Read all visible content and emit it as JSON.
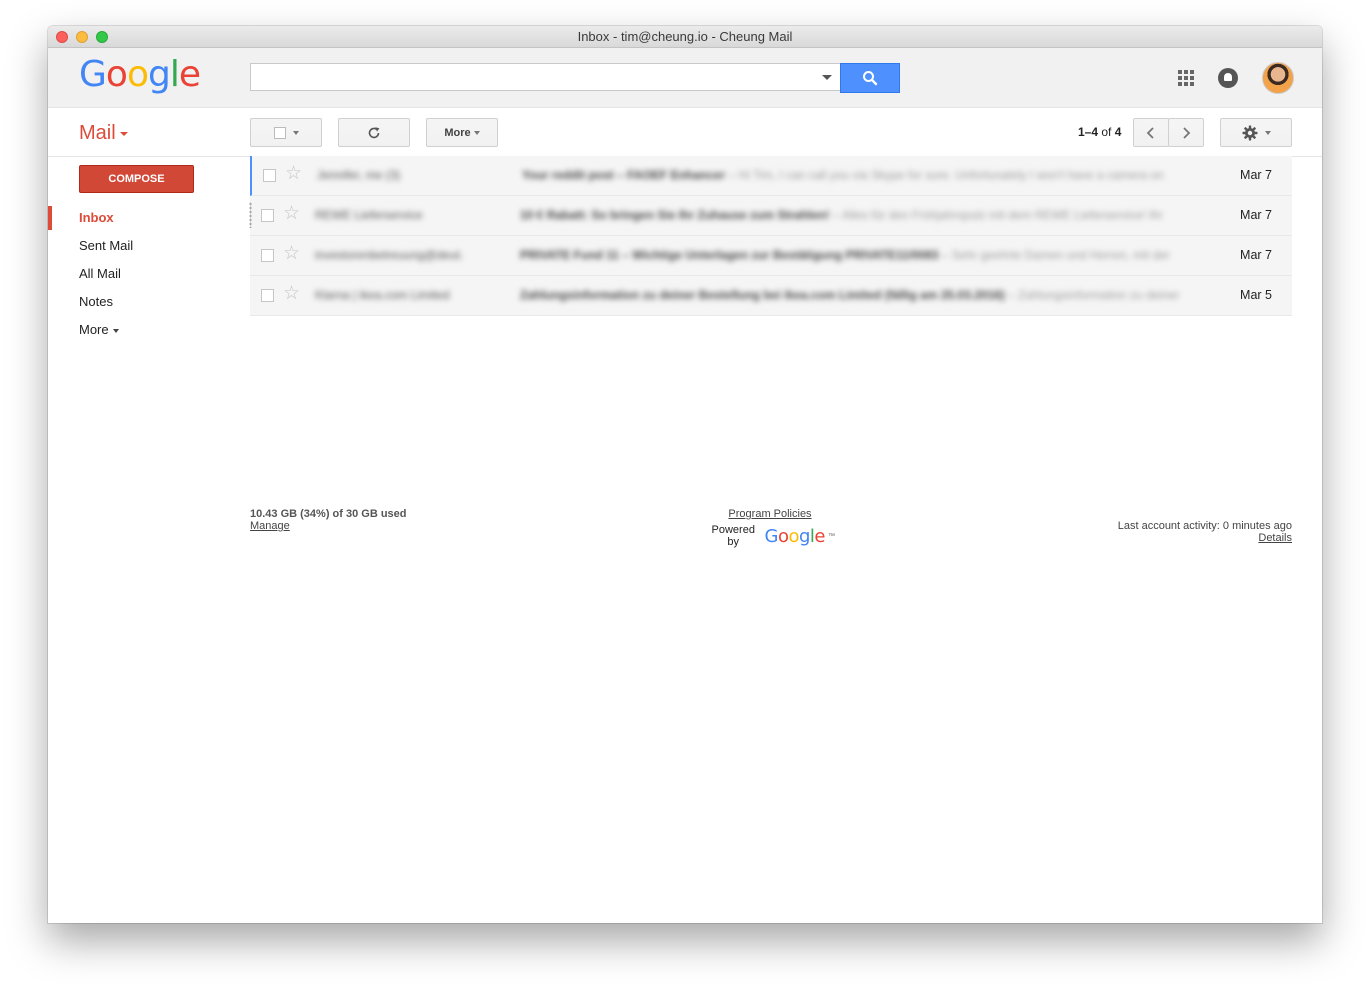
{
  "window": {
    "title": "Inbox - tim@cheung.io - Cheung Mail"
  },
  "brand": {
    "logo_letters": [
      {
        "ch": "G",
        "color": "#4285f4"
      },
      {
        "ch": "o",
        "color": "#ea4335"
      },
      {
        "ch": "o",
        "color": "#fbbc05"
      },
      {
        "ch": "g",
        "color": "#4285f4"
      },
      {
        "ch": "l",
        "color": "#34a853"
      },
      {
        "ch": "e",
        "color": "#ea4335"
      }
    ]
  },
  "search": {
    "placeholder": ""
  },
  "header": {
    "apps_icon": "apps-grid-icon",
    "notifications_icon": "bell-icon",
    "avatar": "account-avatar"
  },
  "toolbar": {
    "mail_label": "Mail",
    "more_label": "More",
    "pager": {
      "range": "1–4",
      "of": "of",
      "total": "4"
    }
  },
  "sidebar": {
    "compose_label": "COMPOSE",
    "items": [
      {
        "label": "Inbox"
      },
      {
        "label": "Sent Mail"
      },
      {
        "label": "All Mail"
      },
      {
        "label": "Notes"
      },
      {
        "label": "More"
      }
    ]
  },
  "emails": [
    {
      "sender": "Jennifer, me (3)",
      "subject": "Your reddit post – FAOEF Enhancer",
      "snippet": " – Hi Tim, I can call you via Skype for sure. Unfortunately I won't have a camera on",
      "date": "Mar 7"
    },
    {
      "sender": "REWE Lieferservice",
      "subject": "10 € Rabatt: So bringen Sie Ihr Zuhause zum Strahlen!",
      "snippet": " – Alles für den Frühjahrsputz mit dem REWE Lieferservice! Ihr",
      "date": "Mar 7"
    },
    {
      "sender": "investorenbetreuung@deut.",
      "subject": "PRIVATE Fund 11 – Wichtige Unterlagen zur Bestätigung PRIVATE11/0083",
      "snippet": " – Sehr geehrte Damen und Herren, mit der",
      "date": "Mar 7"
    },
    {
      "sender": "Klarna | ikea.com Limited",
      "subject": "Zahlungsinformation zu deiner Bestellung bei ikea.com Limited (fällig am 25.03.2016)",
      "snippet": " – Zahlungsinformation zu deiner",
      "date": "Mar 5"
    }
  ],
  "footer": {
    "storage": "10.43 GB (34%) of 30 GB used",
    "manage": "Manage",
    "policies": "Program Policies",
    "powered_by": "Powered by",
    "powered_logo": "Google",
    "activity": "Last account activity: 0 minutes ago",
    "details": "Details"
  }
}
